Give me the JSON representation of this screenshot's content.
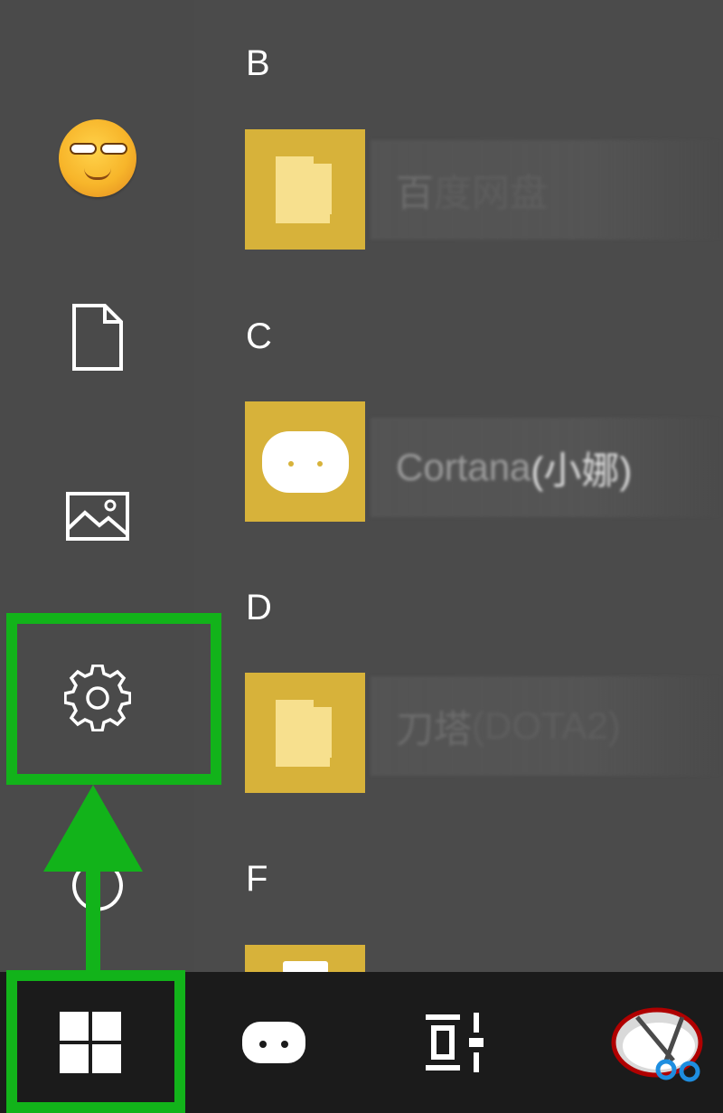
{
  "start_menu": {
    "sections": [
      {
        "letter": "B",
        "app": {
          "name_visible": "百",
          "name_rest": "度网盘",
          "icon": "folder-icon"
        }
      },
      {
        "letter": "C",
        "app": {
          "name_visible": "Cortana ",
          "name_rest": "(小娜)",
          "icon": "cortana-icon"
        }
      },
      {
        "letter": "D",
        "app": {
          "name_visible": "刀塔",
          "name_rest": "(DOTA2)",
          "icon": "folder-icon"
        }
      },
      {
        "letter": "F",
        "app": {
          "name_visible": "",
          "name_rest": "",
          "icon": "folder-icon"
        }
      }
    ],
    "rail": [
      "user-avatar",
      "documents-icon",
      "pictures-icon",
      "settings-icon",
      "power-icon"
    ]
  },
  "taskbar": {
    "items": [
      "windows-start-icon",
      "cortana-icon",
      "task-view-icon",
      "snipping-tool-icon"
    ]
  },
  "colors": {
    "highlight": "#12b31a",
    "tile": "#d7b23a",
    "menu_bg": "#4b4b4b",
    "taskbar_bg": "#1b1b1b"
  }
}
